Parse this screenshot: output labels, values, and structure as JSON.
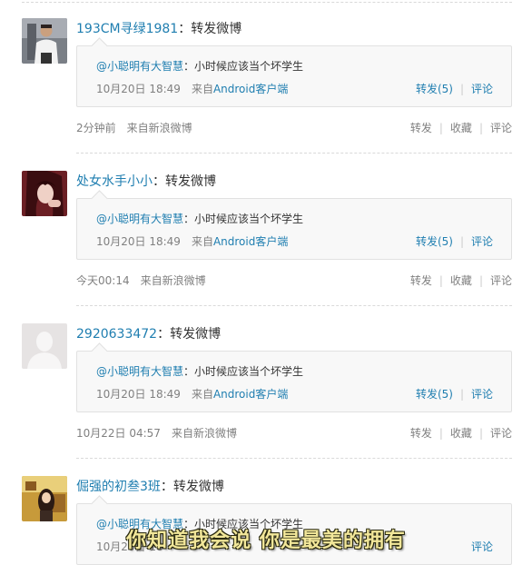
{
  "posts": [
    {
      "author": "193CM寻绿1981",
      "colon": "：",
      "text": "转发微博",
      "quote": {
        "author": "@小聪明有大智慧",
        "colon": "：",
        "text": "小时候应该当个坏学生",
        "date": "10月20日 18:49",
        "from_prefix": "来自",
        "from_app": "Android客户端",
        "repost": "转发(5)",
        "comment": "评论"
      },
      "time": "2分钟前",
      "source": "来自新浪微博",
      "actions": [
        "转发",
        "收藏",
        "评论"
      ],
      "avatar_icon": "user-photo-man"
    },
    {
      "author": "处女水手小小",
      "colon": "：",
      "text": "转发微博",
      "quote": {
        "author": "@小聪明有大智慧",
        "colon": "：",
        "text": "小时候应该当个坏学生",
        "date": "10月20日 18:49",
        "from_prefix": "来自",
        "from_app": "Android客户端",
        "repost": "转发(5)",
        "comment": "评论"
      },
      "time": "今天00:14",
      "source": "来自新浪微博",
      "actions": [
        "转发",
        "收藏",
        "评论"
      ],
      "avatar_icon": "user-photo-girl"
    },
    {
      "author": "2920633472",
      "colon": "：",
      "text": "转发微博",
      "quote": {
        "author": "@小聪明有大智慧",
        "colon": "：",
        "text": "小时候应该当个坏学生",
        "date": "10月20日 18:49",
        "from_prefix": "来自",
        "from_app": "Android客户端",
        "repost": "转发(5)",
        "comment": "评论"
      },
      "time": "10月22日 04:57",
      "source": "来自新浪微博",
      "actions": [
        "转发",
        "收藏",
        "评论"
      ],
      "avatar_icon": "default-avatar-silhouette"
    },
    {
      "author": "倔强的初叁3班",
      "colon": "：",
      "text": "转发微博",
      "quote": {
        "author": "@小聪明有大智慧",
        "colon": "：",
        "text": "小时候应该当个坏学生",
        "date": "10月20日 18",
        "from_prefix": "",
        "from_app": "",
        "repost": "",
        "comment": "评论"
      },
      "avatar_icon": "user-photo-illustration"
    }
  ],
  "subtitle": "你知道我会说 你是最美的拥有",
  "colors": {
    "link": "#1f7eb0",
    "meta": "#808080",
    "quote_bg": "#f8f8f8"
  }
}
